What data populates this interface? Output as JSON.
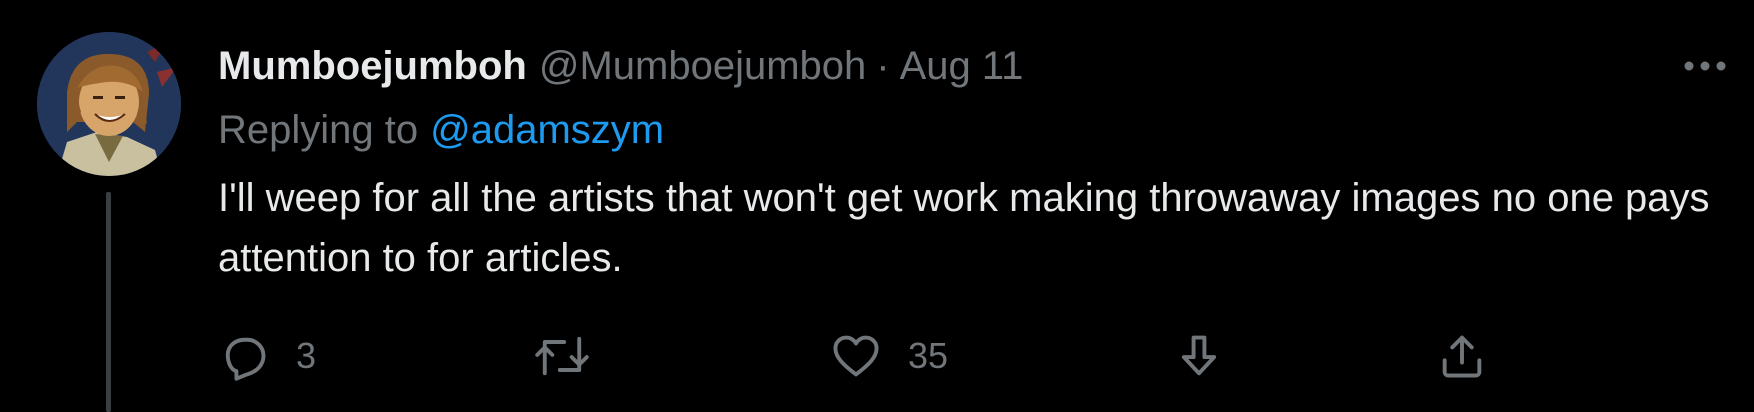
{
  "tweet": {
    "display_name": "Mumboejumboh",
    "handle": "@Mumboejumboh",
    "separator": "·",
    "date": "Aug 11",
    "replying_prefix": "Replying to",
    "replying_to": "@adamszym",
    "text": "I'll weep for all the artists that won't get work making throwaway images no one pays attention to for articles.",
    "more_icon": "more-horizontal-icon"
  },
  "actions": {
    "reply": {
      "icon": "reply-icon",
      "count": "3"
    },
    "retweet": {
      "icon": "retweet-icon",
      "count": ""
    },
    "like": {
      "icon": "heart-icon",
      "count": "35"
    },
    "download": {
      "icon": "arrow-down-icon"
    },
    "share": {
      "icon": "share-icon"
    }
  },
  "colors": {
    "background": "#000000",
    "primary_text": "#e7e9ea",
    "secondary_text": "#71767b",
    "link": "#1d9bf0",
    "thread_line": "#3a3e42"
  }
}
